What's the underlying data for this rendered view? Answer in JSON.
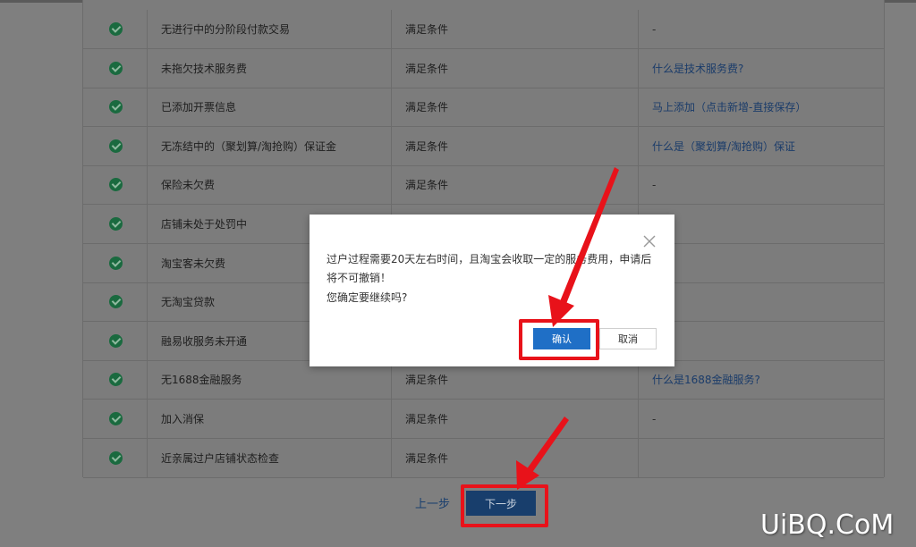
{
  "table": {
    "rows": [
      {
        "name": "无进行中的分阶段付款交易",
        "status": "满足条件",
        "link": "-",
        "is_link": false
      },
      {
        "name": "未拖欠技术服务费",
        "status": "满足条件",
        "link": "什么是技术服务费?",
        "is_link": true
      },
      {
        "name": "已添加开票信息",
        "status": "满足条件",
        "link": "马上添加（点击新增-直接保存）",
        "is_link": true
      },
      {
        "name": "无冻结中的（聚划算/淘抢购）保证金",
        "status": "满足条件",
        "link": "什么是（聚划算/淘抢购）保证",
        "is_link": true
      },
      {
        "name": "保险未欠费",
        "status": "满足条件",
        "link": "-",
        "is_link": false
      },
      {
        "name": "店铺未处于处罚中",
        "status": "",
        "link": "",
        "is_link": false
      },
      {
        "name": "淘宝客未欠费",
        "status": "",
        "link": "",
        "is_link": false
      },
      {
        "name": "无淘宝贷款",
        "status": "",
        "link": "",
        "is_link": false
      },
      {
        "name": "融易收服务未开通",
        "status": "",
        "link": "",
        "is_link": false
      },
      {
        "name": "无1688金融服务",
        "status": "满足条件",
        "link": "什么是1688金融服务?",
        "is_link": true
      },
      {
        "name": "加入消保",
        "status": "满足条件",
        "link": "-",
        "is_link": false
      },
      {
        "name": "近亲属过户店铺状态检查",
        "status": "满足条件",
        "link": "",
        "is_link": false
      }
    ]
  },
  "nav": {
    "prev_label": "上一步",
    "next_label": "下一步"
  },
  "dialog": {
    "message": "过户过程需要20天左右时间，且淘宝会收取一定的服务费用，申请后将不可撤销！",
    "question": "您确定要继续吗?",
    "confirm_label": "确认",
    "cancel_label": "取消"
  },
  "icons": {
    "row_status": "check-circle-icon",
    "dialog_close": "close-icon"
  },
  "colors": {
    "success_green": "#1a6a3f",
    "primary_blue": "#1f6fc6",
    "highlight_red": "#e8121a"
  },
  "watermark": {
    "text": "UiBQ.CoM"
  }
}
